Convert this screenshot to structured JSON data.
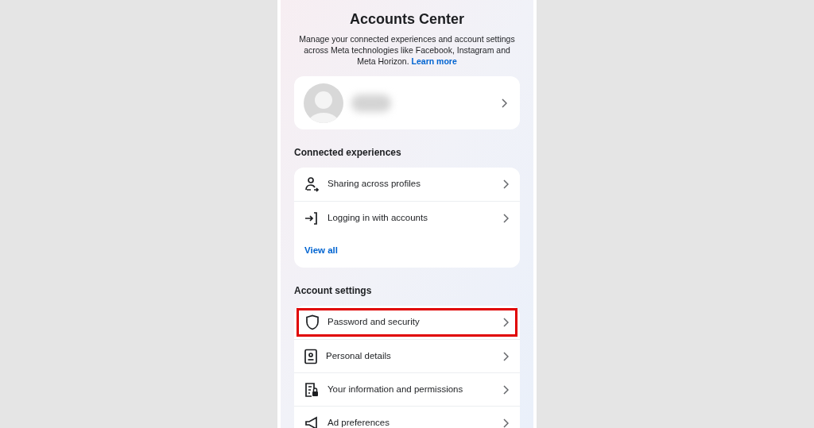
{
  "header": {
    "title": "Accounts Center",
    "description": "Manage your connected experiences and account settings across Meta technologies like Facebook, Instagram and Meta Horizon.",
    "link": "Learn more"
  },
  "profile": {
    "kind": "profile"
  },
  "sections": [
    {
      "title": "Connected experiences",
      "items": [
        {
          "label": "Sharing across profiles",
          "highlighted": false
        },
        {
          "label": "Logging in with accounts",
          "highlighted": false
        }
      ],
      "footer_link": "View all"
    },
    {
      "title": "Account settings",
      "items": [
        {
          "label": "Password and security",
          "highlighted": true
        },
        {
          "label": "Personal details",
          "highlighted": false
        },
        {
          "label": "Your information and permissions",
          "highlighted": false
        },
        {
          "label": "Ad preferences",
          "highlighted": false
        }
      ]
    }
  ]
}
